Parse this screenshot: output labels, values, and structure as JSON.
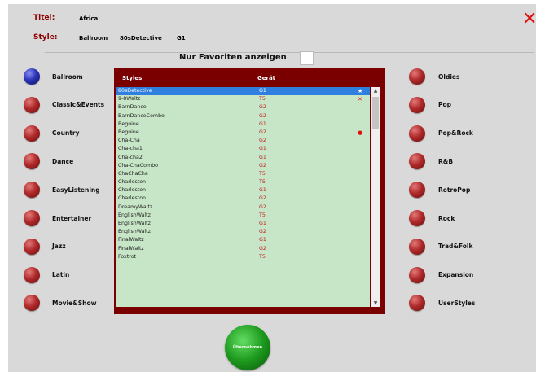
{
  "header": {
    "title_label": "Titel:",
    "title_value": "Africa",
    "style_label": "Style:",
    "style_values": [
      "Ballroom",
      "80sDetective",
      "G1"
    ]
  },
  "close_icon": "close-x-icon",
  "favorites": {
    "label": "Nur Favoriten anzeigen",
    "checked": false
  },
  "left_categories": [
    {
      "label": "Ballroom",
      "color": "blue",
      "selected": true
    },
    {
      "label": "Classic&Events",
      "color": "red"
    },
    {
      "label": "Country",
      "color": "red"
    },
    {
      "label": "Dance",
      "color": "red"
    },
    {
      "label": "EasyListening",
      "color": "red"
    },
    {
      "label": "Entertainer",
      "color": "red"
    },
    {
      "label": "Jazz",
      "color": "red"
    },
    {
      "label": "Latin",
      "color": "red"
    },
    {
      "label": "Movie&Show",
      "color": "red"
    }
  ],
  "right_categories": [
    {
      "label": "Oldies",
      "color": "red"
    },
    {
      "label": "Pop",
      "color": "red"
    },
    {
      "label": "Pop&Rock",
      "color": "red"
    },
    {
      "label": "R&B",
      "color": "red"
    },
    {
      "label": "RetroPop",
      "color": "red"
    },
    {
      "label": "Rock",
      "color": "red"
    },
    {
      "label": "Trad&Folk",
      "color": "red"
    },
    {
      "label": "Expansion",
      "color": "red"
    },
    {
      "label": "UserStyles",
      "color": "red"
    }
  ],
  "table": {
    "headers": {
      "styles": "Styles",
      "device": "Gerät"
    },
    "rows": [
      {
        "name": "80sDetective",
        "device": "G1",
        "mark": "star",
        "selected": true
      },
      {
        "name": "9-8Waltz",
        "device": "T5",
        "mark": "x"
      },
      {
        "name": "BarnDance",
        "device": "G2"
      },
      {
        "name": "BarnDanceCombo",
        "device": "G2"
      },
      {
        "name": "Beguine",
        "device": "G1"
      },
      {
        "name": "Beguine",
        "device": "G2",
        "mark": "dot"
      },
      {
        "name": "Cha-Cha",
        "device": "G2"
      },
      {
        "name": "Cha-cha1",
        "device": "G1"
      },
      {
        "name": "Cha-cha2",
        "device": "G1"
      },
      {
        "name": "Cha-ChaCombo",
        "device": "G2"
      },
      {
        "name": "ChaChaCha",
        "device": "T5"
      },
      {
        "name": "Charleston",
        "device": "T5"
      },
      {
        "name": "Charleston",
        "device": "G1"
      },
      {
        "name": "Charleston",
        "device": "G2"
      },
      {
        "name": "DreamyWaltz",
        "device": "G2"
      },
      {
        "name": "EnglishWaltz",
        "device": "T5"
      },
      {
        "name": "EnglishWaltz",
        "device": "G1"
      },
      {
        "name": "EnglishWaltz",
        "device": "G2"
      },
      {
        "name": "FinalWaltz",
        "device": "G1"
      },
      {
        "name": "FinalWaltz",
        "device": "G2"
      },
      {
        "name": "Foxtrot",
        "device": "T5"
      }
    ]
  },
  "ok_button": {
    "label": "Übernehmen"
  },
  "colors": {
    "accent": "#7a0000",
    "list_bg": "#c7e6c7",
    "selection": "#2f7fe0",
    "close": "#e01010",
    "ok": "#1d9a1d"
  }
}
